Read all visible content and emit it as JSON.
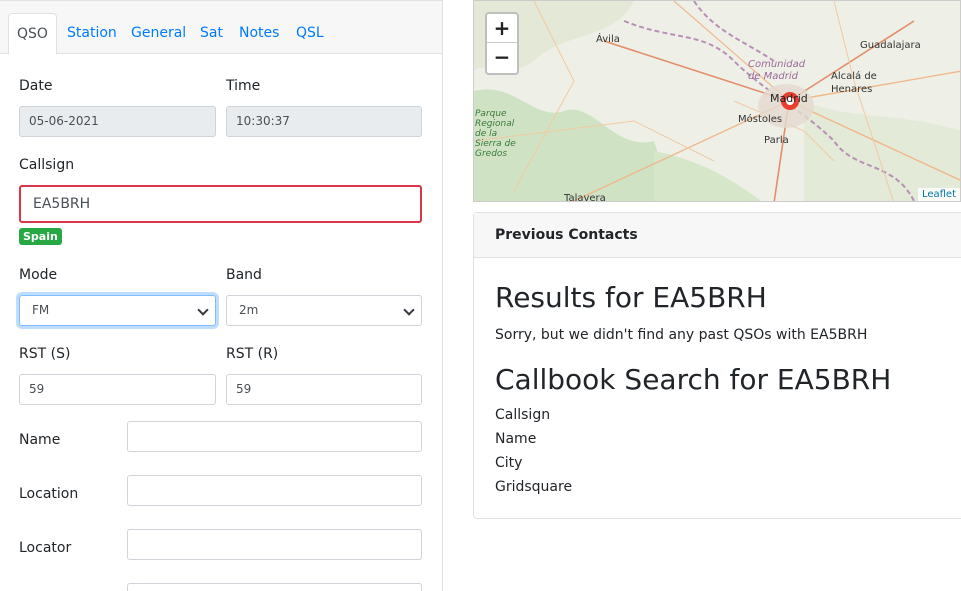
{
  "tabs": [
    {
      "label": "QSO",
      "active": true
    },
    {
      "label": "Station"
    },
    {
      "label": "General"
    },
    {
      "label": "Sat"
    },
    {
      "label": "Notes"
    },
    {
      "label": "QSL"
    }
  ],
  "form": {
    "date_label": "Date",
    "date_value": "05-06-2021",
    "time_label": "Time",
    "time_value": "10:30:37",
    "callsign_label": "Callsign",
    "callsign_value": "EA5BRH",
    "country_badge": "Spain",
    "mode_label": "Mode",
    "mode_value": "FM",
    "band_label": "Band",
    "band_value": "2m",
    "rst_s_label": "RST (S)",
    "rst_s_value": "59",
    "rst_r_label": "RST (R)",
    "rst_r_value": "59",
    "name_label": "Name",
    "name_value": "",
    "location_label": "Location",
    "location_value": "",
    "locator_label": "Locator",
    "locator_value": ""
  },
  "map": {
    "zoom_in": "+",
    "zoom_out": "−",
    "attribution": "Leaflet",
    "places": [
      {
        "name": "Ávila"
      },
      {
        "name": "Guadalajara"
      },
      {
        "name": "Comunidad de Madrid"
      },
      {
        "name": "Alcalá de Henares"
      },
      {
        "name": "Madrid"
      },
      {
        "name": "Móstoles"
      },
      {
        "name": "Parla"
      },
      {
        "name": "Parque Regional de la Sierra de Gredos"
      },
      {
        "name": "Talavera"
      }
    ]
  },
  "previous_contacts": {
    "header": "Previous Contacts",
    "results_title": "Results for EA5BRH",
    "results_text": "Sorry, but we didn't find any past QSOs with EA5BRH",
    "callbook_title": "Callbook Search for EA5BRH",
    "fields": [
      "Callsign",
      "Name",
      "City",
      "Gridsquare"
    ]
  },
  "colors": {
    "accent": "#007bff",
    "invalid": "#dc3545",
    "success": "#28a745",
    "marker": "#e8402f"
  }
}
